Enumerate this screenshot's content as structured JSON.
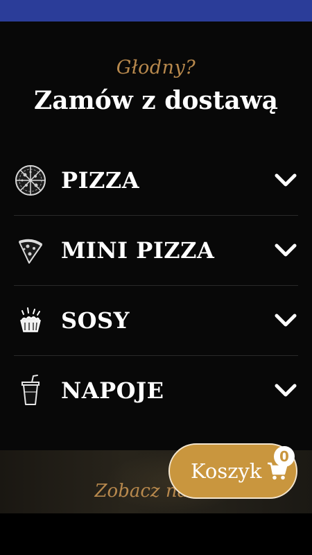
{
  "header": {
    "tagline": "Głodny?",
    "title": "Zamów z dostawą"
  },
  "menu": {
    "items": [
      {
        "label": "PIZZA",
        "icon": "pizza-icon"
      },
      {
        "label": "MINI PIZZA",
        "icon": "pizza-slice-icon"
      },
      {
        "label": "SOSY",
        "icon": "sauce-cup-icon"
      },
      {
        "label": "NAPOJE",
        "icon": "drink-cup-icon"
      }
    ]
  },
  "banner": {
    "text": "Zobacz nasze"
  },
  "cart": {
    "label": "Koszyk",
    "count": "0",
    "icon": "cart-icon"
  },
  "colors": {
    "status_bar": "#2b3d99",
    "accent": "#c9963e",
    "gold_text": "#b8894d",
    "background": "#080808"
  }
}
